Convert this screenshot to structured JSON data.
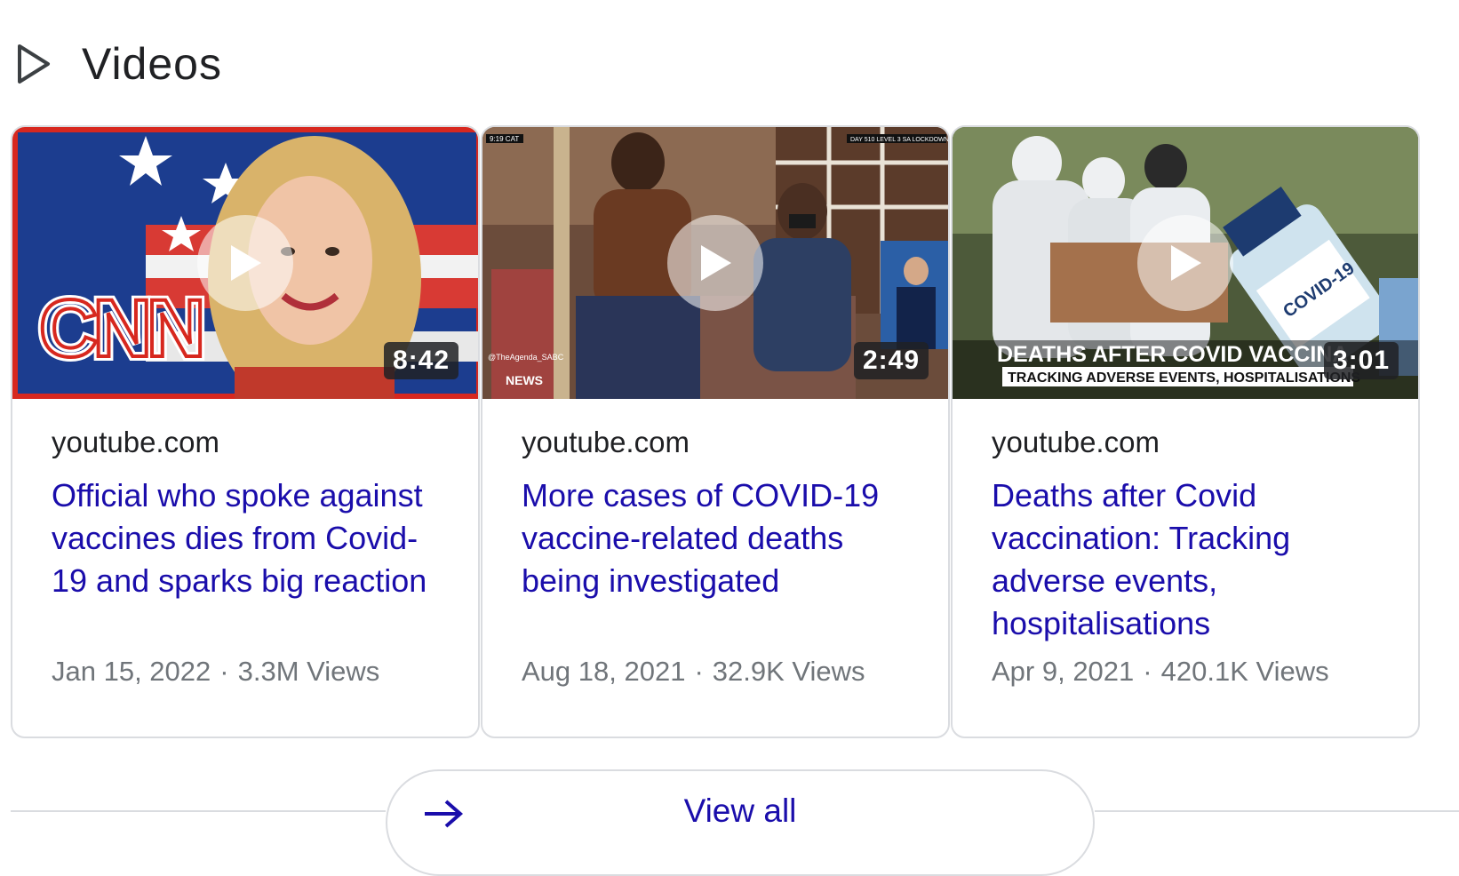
{
  "section": {
    "title": "Videos",
    "icon": "play-outline-icon"
  },
  "cards": [
    {
      "source": "youtube.com",
      "title": "Official who spoke against vaccines dies from Covid-19 and sparks big reaction",
      "date": "Jan 15, 2022",
      "views": "3.3M Views",
      "duration": "8:42",
      "thumbnail_logo": "CNN"
    },
    {
      "source": "youtube.com",
      "title": "More cases of COVID-19 vaccine-related deaths being investigated",
      "date": "Aug 18, 2021",
      "views": "32.9K Views",
      "duration": "2:49",
      "thumbnail_logo": "SABC NEWS"
    },
    {
      "source": "youtube.com",
      "title": "Deaths after Covid vaccination: Tracking adverse events, hospitalisations",
      "date": "Apr 9, 2021",
      "views": "420.1K Views",
      "duration": "3:01",
      "thumbnail_caption": "DEATHS AFTER COVID VACCINATION",
      "thumbnail_subcaption": "TRACKING ADVERSE EVENTS, HOSPITALISATIONS"
    }
  ],
  "footer": {
    "view_all_label": "View all",
    "arrow_icon": "arrow-right-icon"
  },
  "colors": {
    "link": "#1a0dab",
    "muted": "#70757a",
    "border": "#dadce0"
  }
}
